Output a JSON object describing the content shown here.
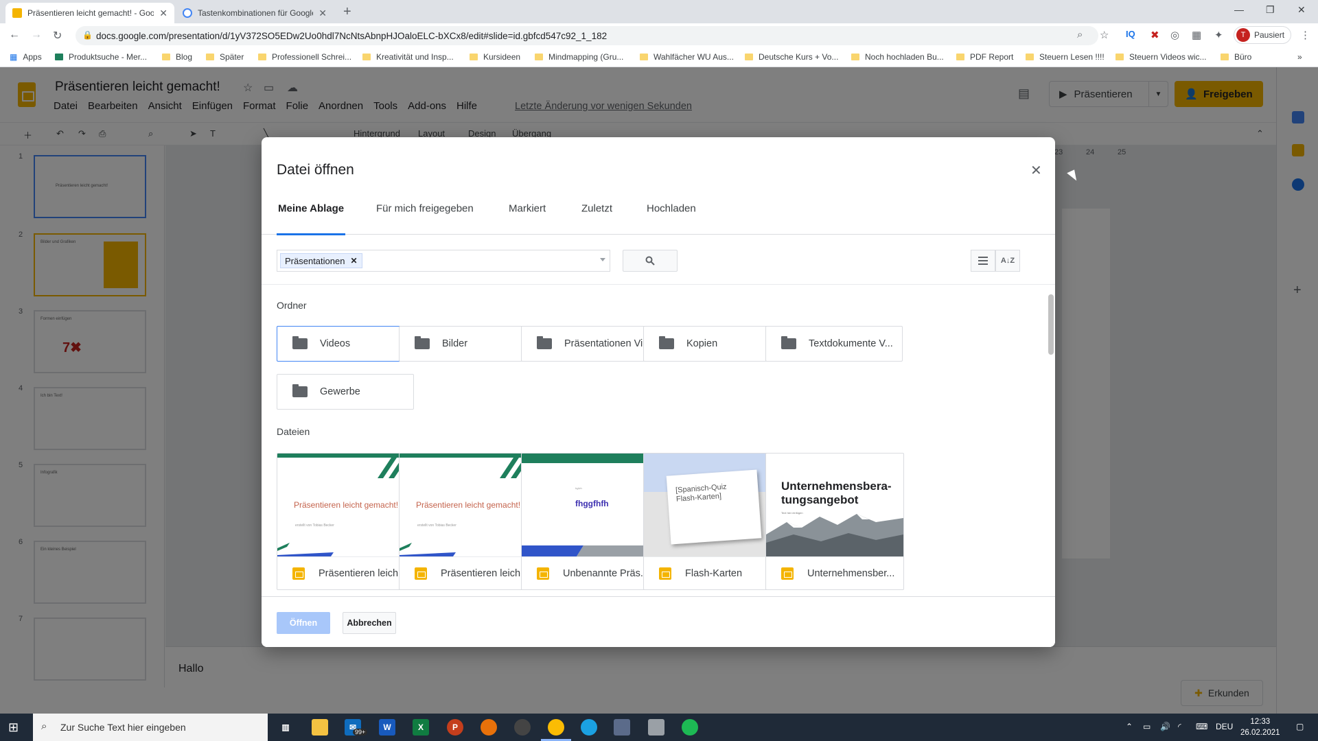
{
  "browser": {
    "tabs": [
      {
        "title": "Präsentieren leicht gemacht! - Google Präsentationen"
      },
      {
        "title": "Tastenkombinationen für Google Präsentationen"
      }
    ],
    "url": "docs.google.com/presentation/d/1yV372SO5EDw2Uo0hdl7NcNtsAbnpHJOaloELC-bXCx8/edit#slide=id.gbfcd547c92_1_182",
    "profile_label": "Pausiert",
    "profile_initial": "T",
    "bookmarks": [
      "Apps",
      "Produktsuche - Mer...",
      "Blog",
      "Später",
      "Professionell Schrei...",
      "Kreativität und Insp...",
      "Kursideen",
      "Mindmapping (Gru...",
      "Wahlfächer WU Aus...",
      "Deutsche Kurs + Vo...",
      "Noch hochladen Bu...",
      "PDF Report",
      "Steuern Lesen !!!!",
      "Steuern Videos wic...",
      "Büro"
    ]
  },
  "slides_app": {
    "doc_title": "Präsentieren leicht gemacht!",
    "menu": [
      "Datei",
      "Bearbeiten",
      "Ansicht",
      "Einfügen",
      "Format",
      "Folie",
      "Anordnen",
      "Tools",
      "Add-ons",
      "Hilfe"
    ],
    "last_edit": "Letzte Änderung vor wenigen Sekunden",
    "present_label": "Präsentieren",
    "share_label": "Freigeben",
    "toolbar_items": [
      "Hintergrund",
      "Layout",
      "Design",
      "Übergang"
    ],
    "ruler_numbers": [
      "23",
      "24",
      "25"
    ],
    "slide_numbers": [
      "1",
      "2",
      "3",
      "4",
      "5",
      "6",
      "7"
    ],
    "thumb_texts": [
      "Präsentieren leicht gemacht!",
      "Bilder und Grafiken",
      "Formen einfügen",
      "Ich bin Text!",
      "Infografik",
      "Ein kleines Beispiel",
      ""
    ],
    "thumb3_glyph": "7✖",
    "notes_text": "Hallo",
    "explore_label": "Erkunden"
  },
  "dialog": {
    "title": "Datei öffnen",
    "tabs": [
      "Meine Ablage",
      "Für mich freigegeben",
      "Markiert",
      "Zuletzt",
      "Hochladen"
    ],
    "filter_chip": "Präsentationen",
    "section_folders": "Ordner",
    "section_files": "Dateien",
    "folders": [
      "Videos",
      "Bilder",
      "Präsentationen Vi...",
      "Kopien",
      "Textdokumente V...",
      "Gewerbe"
    ],
    "files": [
      {
        "name": "Präsentieren leich...",
        "preview_title": "Präsentieren leicht gemacht!",
        "preview_sub": "erstellt von Tobias Becker"
      },
      {
        "name": "Präsentieren leich...",
        "preview_title": "Präsentieren leicht gemacht!",
        "preview_sub": "erstellt von Tobias Becker"
      },
      {
        "name": "Unbenannte Präs...",
        "preview_title": "fhggfhfh",
        "preview_sub": "hgfvh"
      },
      {
        "name": "Flash-Karten",
        "preview_title": "[Spanisch-Quiz Flash-Karten]"
      },
      {
        "name": "Unternehmensber...",
        "preview_title": "Unternehmensbera-tungsangebot",
        "preview_sub": "Text hier einfügen"
      }
    ],
    "open_label": "Öffnen",
    "cancel_label": "Abbrechen"
  },
  "taskbar": {
    "search_placeholder": "Zur Suche Text hier eingeben",
    "mail_badge": "99+",
    "language": "DEU",
    "time": "12:33",
    "date": "26.02.2021"
  },
  "colors": {
    "accent": "#1a73e8",
    "slides_yellow": "#f4b400",
    "green": "#1e7f5c"
  }
}
